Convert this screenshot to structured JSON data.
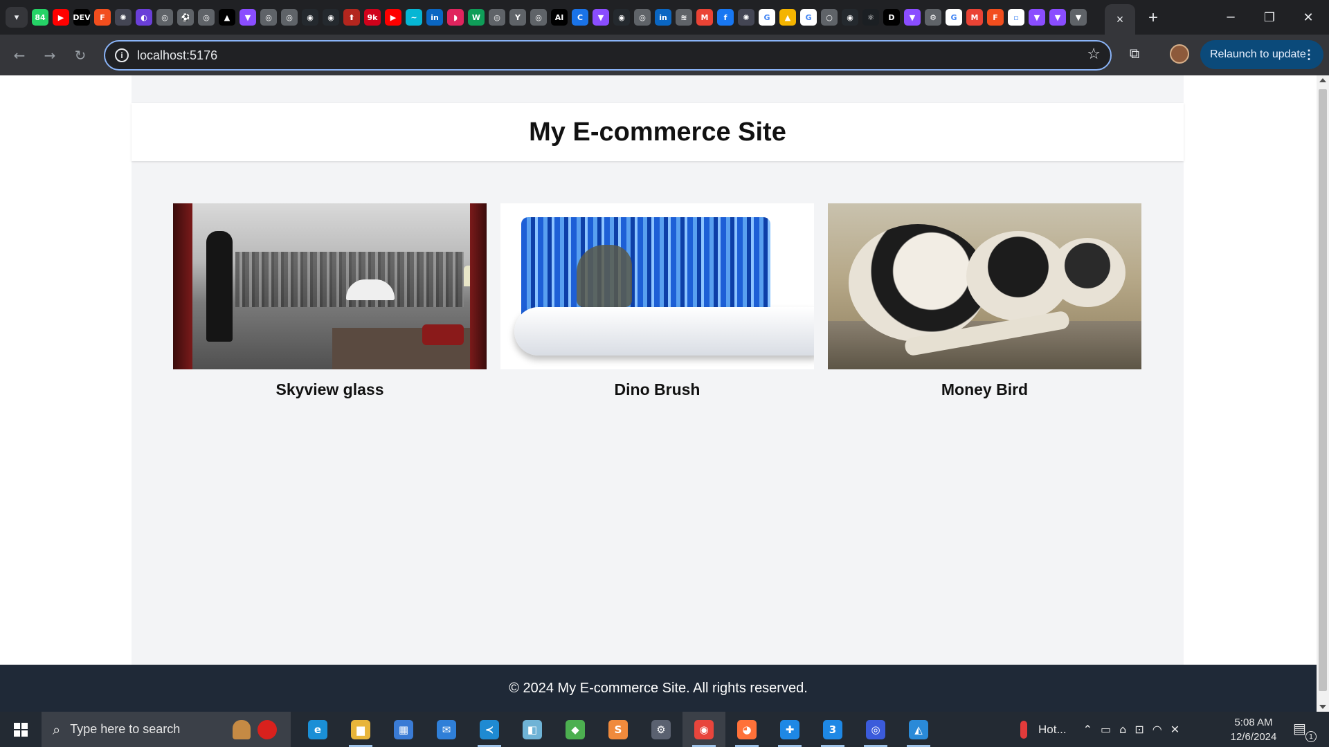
{
  "browser": {
    "tab_search_icon": "chevron-down-icon",
    "pinned_tabs": [
      {
        "icon": "whatsapp-icon",
        "glyph": "84",
        "color": "#25d366"
      },
      {
        "icon": "youtube-icon",
        "glyph": "▶",
        "color": "#ff0000"
      },
      {
        "icon": "dev-icon",
        "glyph": "DEV",
        "color": "#000000"
      },
      {
        "icon": "figma-icon",
        "glyph": "F",
        "color": "#f24e1e"
      },
      {
        "icon": "chatgpt-icon",
        "glyph": "✺",
        "color": "#444654"
      },
      {
        "icon": "colorful-icon",
        "glyph": "◐",
        "color": "#6a3fd8"
      },
      {
        "icon": "globe-icon",
        "glyph": "◎",
        "color": "#5f6368"
      },
      {
        "icon": "ball-icon",
        "glyph": "⚽",
        "color": "#5f6368"
      },
      {
        "icon": "globe-icon",
        "glyph": "◎",
        "color": "#5f6368"
      },
      {
        "icon": "triangle-icon",
        "glyph": "▲",
        "color": "#000000"
      },
      {
        "icon": "vite-icon",
        "glyph": "▼",
        "color": "#8a4dff"
      },
      {
        "icon": "globe-icon",
        "glyph": "◎",
        "color": "#5f6368"
      },
      {
        "icon": "globe-icon",
        "glyph": "◎",
        "color": "#5f6368"
      },
      {
        "icon": "github-icon",
        "glyph": "◉",
        "color": "#24292e"
      },
      {
        "icon": "github-icon",
        "glyph": "◉",
        "color": "#24292e"
      },
      {
        "icon": "pin-icon",
        "glyph": "⬆",
        "color": "#b3261e"
      },
      {
        "icon": "counter-icon",
        "glyph": "9k",
        "color": "#d0021b"
      },
      {
        "icon": "youtube-icon",
        "glyph": "▶",
        "color": "#ff0000"
      },
      {
        "icon": "tailwind-icon",
        "glyph": "~",
        "color": "#06b6d4"
      },
      {
        "icon": "linkedin-icon",
        "glyph": "in",
        "color": "#0a66c2"
      },
      {
        "icon": "red-icon",
        "glyph": "◗",
        "color": "#e0245e"
      },
      {
        "icon": "w-icon",
        "glyph": "W",
        "color": "#0f9d58"
      },
      {
        "icon": "globe-icon",
        "glyph": "◎",
        "color": "#5f6368"
      },
      {
        "icon": "yc-icon",
        "glyph": "Y",
        "color": "#5f6368"
      },
      {
        "icon": "globe-icon",
        "glyph": "◎",
        "color": "#5f6368"
      },
      {
        "icon": "ai-icon",
        "glyph": "AI",
        "color": "#000000"
      },
      {
        "icon": "c-icon",
        "glyph": "C",
        "color": "#1a73e8"
      },
      {
        "icon": "vite-icon",
        "glyph": "▼",
        "color": "#8a4dff"
      },
      {
        "icon": "github-icon",
        "glyph": "◉",
        "color": "#24292e"
      },
      {
        "icon": "globe-icon",
        "glyph": "◎",
        "color": "#5f6368"
      },
      {
        "icon": "linkedin-icon",
        "glyph": "in",
        "color": "#0a66c2"
      },
      {
        "icon": "stack-icon",
        "glyph": "≋",
        "color": "#5f6368"
      },
      {
        "icon": "gmail-icon",
        "glyph": "M",
        "color": "#ea4335"
      },
      {
        "icon": "facebook-icon",
        "glyph": "f",
        "color": "#1877f2"
      },
      {
        "icon": "chatgpt-icon",
        "glyph": "✺",
        "color": "#444654"
      },
      {
        "icon": "google-icon",
        "glyph": "G",
        "color": "#ffffff"
      },
      {
        "icon": "drive-icon",
        "glyph": "▲",
        "color": "#f4b400"
      },
      {
        "icon": "google-icon",
        "glyph": "G",
        "color": "#ffffff"
      },
      {
        "icon": "circle-icon",
        "glyph": "○",
        "color": "#5f6368"
      },
      {
        "icon": "github-icon",
        "glyph": "◉",
        "color": "#24292e"
      },
      {
        "icon": "react-icon",
        "glyph": "⚛",
        "color": "#1b1f23"
      },
      {
        "icon": "d-icon",
        "glyph": "D",
        "color": "#000000"
      },
      {
        "icon": "vite-icon",
        "glyph": "▼",
        "color": "#8a4dff"
      },
      {
        "icon": "gear-icon",
        "glyph": "⚙",
        "color": "#5f6368"
      },
      {
        "icon": "google-icon",
        "glyph": "G",
        "color": "#ffffff"
      },
      {
        "icon": "gmail-icon",
        "glyph": "M",
        "color": "#ea4335"
      },
      {
        "icon": "figma-icon",
        "glyph": "F",
        "color": "#f24e1e"
      },
      {
        "icon": "doc-icon",
        "glyph": "▫",
        "color": "#ffffff"
      },
      {
        "icon": "vite-icon",
        "glyph": "▼",
        "color": "#8a4dff"
      },
      {
        "icon": "vite-icon",
        "glyph": "▼",
        "color": "#8a4dff"
      },
      {
        "icon": "vite-icon",
        "glyph": "▼",
        "color": "#5f6368"
      }
    ],
    "active_tab_close": "×",
    "new_tab": "+",
    "window_controls": {
      "minimize": "─",
      "restore": "❐",
      "close": "✕"
    },
    "nav": {
      "back": "←",
      "forward": "→",
      "reload": "↻"
    },
    "url": "localhost:5176",
    "info_glyph": "i",
    "star_glyph": "☆",
    "extensions_glyph": "⧉",
    "relaunch_label": "Relaunch to update",
    "relaunch_menu": "⋮"
  },
  "page": {
    "site_title": "My E-commerce Site",
    "products": [
      {
        "name": "Skyview glass"
      },
      {
        "name": "Dino Brush"
      },
      {
        "name": "Money Bird"
      }
    ],
    "footer": "© 2024 My E-commerce Site. All rights reserved."
  },
  "taskbar": {
    "search_placeholder": "Type here to search",
    "apps": [
      {
        "name": "edge-icon",
        "glyph": "e",
        "color": "#1a8fd6",
        "running": false,
        "active": false
      },
      {
        "name": "file-explorer-icon",
        "glyph": "▆",
        "color": "#e8b53a",
        "running": true,
        "active": false
      },
      {
        "name": "store-icon",
        "glyph": "▦",
        "color": "#3a7bd5",
        "running": false,
        "active": false
      },
      {
        "name": "mail-icon",
        "glyph": "✉",
        "color": "#2f7fd8",
        "running": false,
        "active": false
      },
      {
        "name": "vscode-icon",
        "glyph": "≺",
        "color": "#1f8ad2",
        "running": true,
        "active": false
      },
      {
        "name": "notes-icon",
        "glyph": "◧",
        "color": "#6fb3d6",
        "running": false,
        "active": false
      },
      {
        "name": "git-icon",
        "glyph": "◆",
        "color": "#4caf50",
        "running": false,
        "active": false
      },
      {
        "name": "sublime-icon",
        "glyph": "S",
        "color": "#f08a3c",
        "running": false,
        "active": false
      },
      {
        "name": "settings-icon",
        "glyph": "⚙",
        "color": "#5a6170",
        "running": false,
        "active": false
      },
      {
        "name": "chrome-icon",
        "glyph": "◉",
        "color": "#e8453c",
        "running": true,
        "active": true
      },
      {
        "name": "firefox-icon",
        "glyph": "◕",
        "color": "#ff7139",
        "running": true,
        "active": false
      },
      {
        "name": "medical-icon",
        "glyph": "✚",
        "color": "#1e88e5",
        "running": true,
        "active": false
      },
      {
        "name": "three-icon",
        "glyph": "3",
        "color": "#1e88e5",
        "running": true,
        "active": false
      },
      {
        "name": "photos-icon",
        "glyph": "◎",
        "color": "#3b5bdb",
        "running": true,
        "active": false
      },
      {
        "name": "image-viewer-icon",
        "glyph": "◭",
        "color": "#2a8ad8",
        "running": true,
        "active": false
      }
    ],
    "weather_label": "Hot...",
    "tray_glyphs": [
      "⌃",
      "▭",
      "⌂",
      "⊡",
      "◠",
      "✕"
    ],
    "time": "5:08 AM",
    "date": "12/6/2024",
    "notification_glyph": "▤",
    "notification_count": "1"
  }
}
